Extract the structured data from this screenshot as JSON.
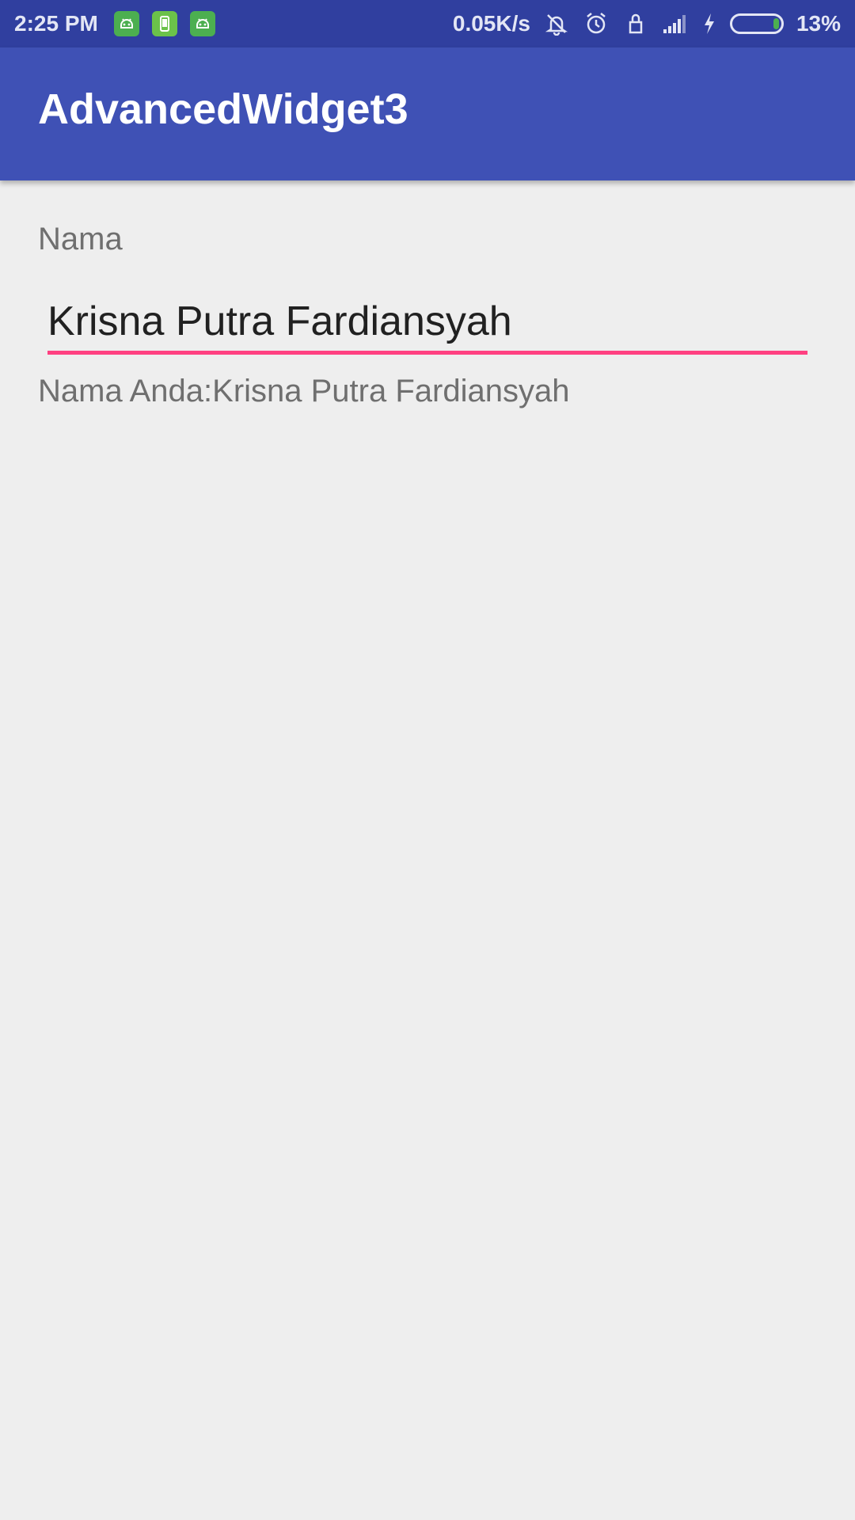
{
  "status_bar": {
    "time": "2:25 PM",
    "network_speed": "0.05K/s",
    "battery_percent": "13%",
    "battery_level": 0.13,
    "notification_icons": [
      "android-icon",
      "phone-icon",
      "android-icon"
    ],
    "indicator_icons": [
      "bell-muted-icon",
      "alarm-icon",
      "lock-icon",
      "signal-icon",
      "charging-icon"
    ]
  },
  "app_bar": {
    "title": "AdvancedWidget3"
  },
  "form": {
    "label": "Nama",
    "input_value": "Krisna Putra Fardiansyah",
    "result_text": "Nama Anda:Krisna Putra Fardiansyah"
  },
  "colors": {
    "status_bar": "#303f9f",
    "app_bar": "#3f51b5",
    "accent": "#ff4081",
    "background": "#eeeeee"
  }
}
